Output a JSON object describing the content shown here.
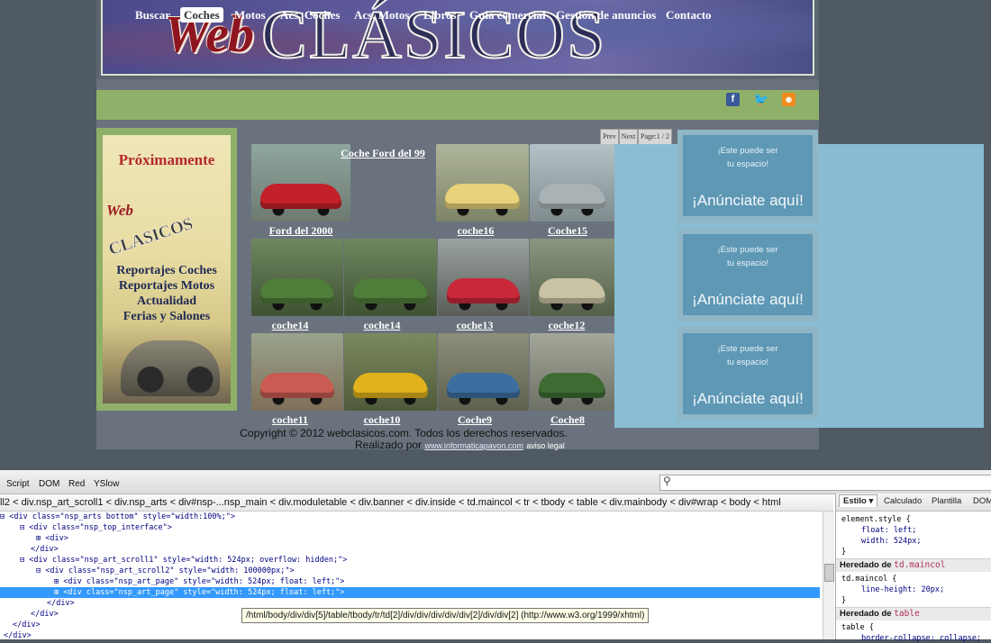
{
  "banner": {
    "logo_web": "Web",
    "logo_clasicos": "CLÁSICOS"
  },
  "nav": {
    "items": [
      "Buscar",
      "Coches",
      "Motos",
      "Acs. Coches",
      "Acs. Motos",
      "Libros",
      "Guia comercial",
      "Gestión de anuncios",
      "Contacto"
    ],
    "active": "Coches"
  },
  "social": {
    "facebook_icon": "f",
    "twitter_icon": "t",
    "rss_icon": "rss"
  },
  "side_ad": {
    "title": "Próximamente",
    "logo_web": "Web",
    "logo_clasicos": "CLASICOS",
    "lines": [
      "Reportajes Coches",
      "Reportajes Motos",
      "Actualidad",
      "Ferias y Salones"
    ]
  },
  "pager": {
    "prev": "Prev",
    "next": "Next",
    "page": "Page:1 / 2"
  },
  "gallery": {
    "title_link": "Coche Ford del 99",
    "items": [
      {
        "label": "Ford del 2000",
        "color": "#c4202a"
      },
      {
        "label": "coche16",
        "color": "#e8d27a"
      },
      {
        "label": "Coche15",
        "color": "#a9b2b4"
      },
      {
        "label": "coche14",
        "color": "#4f7d3a"
      },
      {
        "label": "coche14",
        "color": "#4f7d3a"
      },
      {
        "label": "coche13",
        "color": "#c8283a"
      },
      {
        "label": "coche12",
        "color": "#c9c3a5"
      },
      {
        "label": "coche11",
        "color": "#c95b52"
      },
      {
        "label": "coche10",
        "color": "#e0b21c"
      },
      {
        "label": "Coche9",
        "color": "#3c6fa0"
      },
      {
        "label": "Coche8",
        "color": "#3f6b33"
      }
    ]
  },
  "ads": [
    {
      "small1": "¡Este puede ser",
      "small2": "tu espacio!",
      "big": "¡Anúnciate aquí!"
    },
    {
      "small1": "¡Este puede ser",
      "small2": "tu espacio!",
      "big": "¡Anúnciate aquí!"
    },
    {
      "small1": "¡Este puede ser",
      "small2": "tu espacio!",
      "big": "¡Anúnciate aquí!"
    }
  ],
  "footer": {
    "copyright": "Copyright © 2012 webclasicos.com. Todos los derechos reservados.",
    "made_by": "Realizado por",
    "link": "www.informaticapavon.com",
    "aviso": "aviso legal"
  },
  "firebug": {
    "tabs": [
      "Script",
      "DOM",
      "Red",
      "YSlow"
    ],
    "breadcrumbs": [
      "ll2",
      "div.nsp_art_scroll1",
      "div.nsp_arts",
      "div#nsp-...nsp_main",
      "div.moduletable",
      "div.banner",
      "div.inside",
      "td.maincol",
      "tr",
      "tbody",
      "table",
      "div.mainbody",
      "div#wrap",
      "body",
      "html"
    ],
    "code_lines": [
      {
        "tx": "<div class=\"nsp_arts bottom\" style=\"width:100%;\">",
        "exp": "⊟"
      },
      {
        "tx": "<div class=\"nsp_top_interface\">",
        "exp": "⊟"
      },
      {
        "tx": "<div>",
        "exp": "⊞"
      },
      {
        "tx": "</div>",
        "exp": ""
      },
      {
        "tx": "<div class=\"nsp_art_scroll1\" style=\"width: 524px; overflow: hidden;\">",
        "exp": "⊟"
      },
      {
        "tx": "<div class=\"nsp_art_scroll2\" style=\"width: 100000px;\">",
        "exp": "⊟"
      },
      {
        "tx": "<div class=\"nsp_art_page\" style=\"width: 524px; float: left;\">",
        "exp": "⊞"
      },
      {
        "tx": "<div class=\"nsp_art_page\" style=\"width: 524px; float: left;\">",
        "exp": "⊞"
      },
      {
        "tx": "</div>",
        "exp": ""
      },
      {
        "tx": "</div>",
        "exp": ""
      },
      {
        "tx": "</div>",
        "exp": ""
      },
      {
        "tx": "</div>",
        "exp": ""
      }
    ],
    "tooltip": "/html/body/div/div[5]/table/tbody/tr/td[2]/div/div/div/div/div[2]/div/div[2] (http://www.w3.org/1999/xhtml)",
    "side_tabs": [
      "Estilo ▾",
      "Calculado",
      "Plantilla",
      "DOM"
    ],
    "style": {
      "element_rule": "element.style {",
      "element_props": [
        "float: left;",
        "width: 524px;"
      ],
      "close": "}",
      "inherited1_label": "Heredado de",
      "inherited1_selector": "td.maincol",
      "maincol_rule": "td.maincol {",
      "maincol_props": [
        "line-height: 20px;"
      ],
      "inherited2_label": "Heredado de",
      "inherited2_selector": "table",
      "table_rule": "table {",
      "table_props": [
        "border-collapse: collapse;"
      ]
    }
  }
}
